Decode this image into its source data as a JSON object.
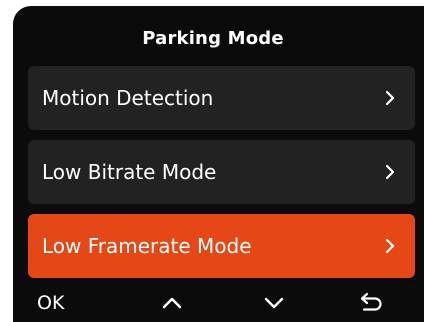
{
  "screen": {
    "title": "Parking Mode"
  },
  "menu": {
    "items": [
      {
        "label": "Motion Detection",
        "selected": false
      },
      {
        "label": "Low Bitrate Mode",
        "selected": false
      },
      {
        "label": "Low Framerate Mode",
        "selected": true
      }
    ]
  },
  "footer": {
    "ok_label": "OK",
    "up_icon": "chevron-up-icon",
    "down_icon": "chevron-down-icon",
    "back_icon": "return-arrow-icon"
  },
  "colors": {
    "background": "#0b0b0b",
    "item_background": "#222222",
    "selected_accent": "#e64716",
    "text": "#ffffff"
  }
}
